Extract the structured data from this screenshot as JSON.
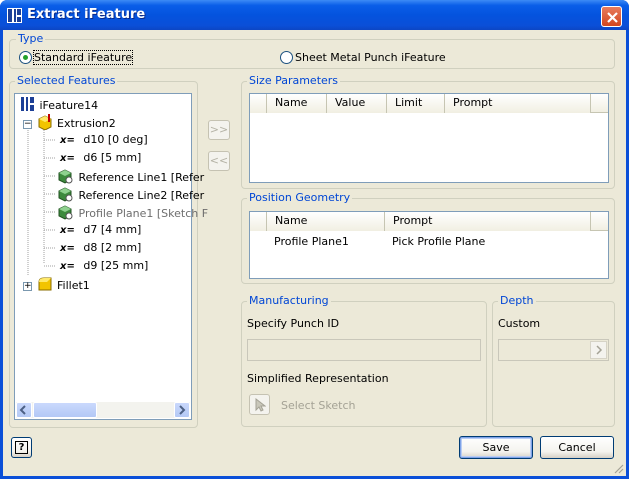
{
  "window": {
    "title": "Extract iFeature"
  },
  "type_group": {
    "legend": "Type",
    "options": [
      {
        "label": "Standard iFeature",
        "checked": true
      },
      {
        "label": "Sheet Metal Punch iFeature",
        "checked": false
      }
    ]
  },
  "selected_features": {
    "legend": "Selected Features",
    "tree": {
      "root": "iFeature14",
      "extrusion": "Extrusion2",
      "params": [
        {
          "prefix": "x=",
          "label": "d10 [0 deg]"
        },
        {
          "prefix": "x=",
          "label": "d6 [5 mm]"
        }
      ],
      "geometry": [
        {
          "label": "Reference Line1 [Refer",
          "dimmed": false
        },
        {
          "label": "Reference Line2 [Refer",
          "dimmed": false
        },
        {
          "label": "Profile Plane1 [Sketch F",
          "dimmed": true
        }
      ],
      "params2": [
        {
          "prefix": "x=",
          "label": "d7 [4 mm]"
        },
        {
          "prefix": "x=",
          "label": "d8 [2 mm]"
        },
        {
          "prefix": "x=",
          "label": "d9 [25 mm]"
        }
      ],
      "fillet": "Fillet1",
      "expander_minus": "−",
      "expander_plus": "+"
    }
  },
  "arrows": {
    "add": ">>",
    "remove": "<<"
  },
  "size_parameters": {
    "legend": "Size Parameters",
    "columns": [
      "Name",
      "Value",
      "Limit",
      "Prompt"
    ]
  },
  "position_geometry": {
    "legend": "Position Geometry",
    "columns": [
      "Name",
      "Prompt"
    ],
    "rows": [
      {
        "name": "Profile Plane1",
        "prompt": "Pick Profile Plane"
      }
    ]
  },
  "manufacturing": {
    "legend": "Manufacturing",
    "punch_id_label": "Specify Punch ID",
    "punch_id_value": "",
    "simplified_label": "Simplified Representation",
    "select_sketch_label": "Select Sketch"
  },
  "depth": {
    "legend": "Depth",
    "label": "Custom",
    "value": ""
  },
  "buttons": {
    "save": "Save",
    "cancel": "Cancel",
    "help": "?"
  },
  "icons": {
    "title": "ifeature-icon",
    "close": "close-icon",
    "root": "ifeature-icon",
    "extrusion": "extrusion-icon",
    "geometry": "reference-geometry-icon",
    "fillet": "fillet-icon",
    "select": "cursor-arrow-icon",
    "help": "help-icon"
  },
  "colors": {
    "accent": "#0046d5",
    "titlebar": "#0a4fd8",
    "face": "#ece9d8"
  }
}
